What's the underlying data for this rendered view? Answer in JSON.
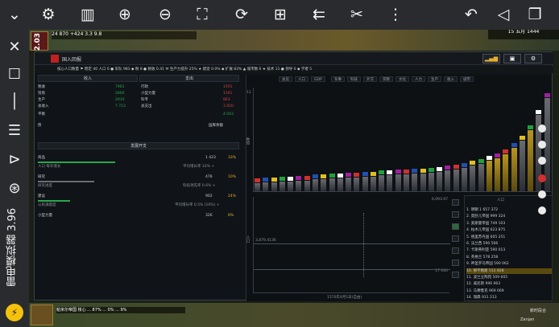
{
  "emulator": {
    "brand": "雷电模拟器 3.96",
    "logo": "⚡",
    "toolbar_icons": [
      "chevron-down-double-icon",
      "gear-icon",
      "sd-card-icon",
      "volume-up-icon",
      "volume-down-icon",
      "screenshot-icon",
      "rotate-icon",
      "add-window-icon",
      "install-apk-icon",
      "scissors-icon",
      "more-icon",
      "back-icon",
      "home-icon",
      "recents-icon"
    ],
    "sidebar_icons": [
      "close-icon",
      "restore-icon",
      "minimize-icon",
      "menu-icon",
      "collapse-icon",
      "gamepad-icon"
    ]
  },
  "game": {
    "topbar": "24 870  +424  3.3  9.8",
    "date": "15 五月 1444",
    "fps": "2.03",
    "dialog_title": "国入回报",
    "resources": "核心人口数量  ⚑ 稳定 40  人口 6  ● 军队 983  ◆ 税 8  ● 税收 0.41  ⚒ 生产力提升 25%  ★ 建造 0.0%  ◆ 扩展 83%  ▲ 城市数 6  ★ 技术 11  ● 领导 0  ◆ 学者 5",
    "left": {
      "income_header": "收入",
      "expense_header": "支出",
      "rows": [
        {
          "label": "税收",
          "val": "7961",
          "r_label": "行政",
          "r_val": "1591"
        },
        {
          "label": "贸易",
          "val": "2800",
          "r_label": "小型力量",
          "r_val": "1591"
        },
        {
          "label": "生产",
          "val": "2910",
          "r_label": "科专",
          "r_val": "863"
        },
        {
          "label": "总收入",
          "val": "7 723",
          "r_label": "总支出",
          "r_val": "3 820"
        }
      ],
      "balance_label": "平衡",
      "balance_val": "4 043",
      "treasury_label": "债",
      "treasury_val": "国库余额",
      "section_header": "发展开支",
      "items": [
        {
          "label": "商品",
          "val": "1 423",
          "pct": "33%",
          "sub": "人口 每年增长",
          "sub2": "平均增长率 10% +"
        },
        {
          "label": "研究",
          "val": "476",
          "pct": "10%",
          "sub": "研究进度",
          "sub2": "科技领先率 0.6% +"
        },
        {
          "label": "建设",
          "val": "902",
          "pct": "24%",
          "sub": "公民满意度",
          "sub2": "平均增长率 0.5% (10%) +"
        },
        {
          "label": "小型力量",
          "val": "326",
          "pct": "8%",
          "sub": "",
          "sub2": ""
        }
      ]
    },
    "right": {
      "tabs": [
        "总览",
        "人口",
        "GDP",
        "军事",
        "科技",
        "外交",
        "宗教",
        "文化",
        "人力",
        "生产",
        "收入",
        "城市"
      ],
      "y_axis_label": "数值",
      "top_axis_value": "11",
      "bottom_y_label": "人口",
      "bottom_axis_max": "6,093.97",
      "bottom_axis_mid": "3,879.4136",
      "bottom_axis_end": "17 060",
      "bottom_x_label": "1570年4月1日(自由)",
      "rank_header": "人口",
      "rank_items": [
        "1. 明朝  1 657 372",
        "2. 莫卧儿帝国  999 324",
        "3. 奥斯曼帝国  749 103",
        "4. 帖木儿帝国  623 875",
        "5. 德里苏丹国  605 251",
        "6. 法兰西  590 566",
        "7. 卡斯蒂利亚  590 013",
        "8. 英格兰  578 258",
        "9. 神圣罗马帝国  590 062",
        "10. 那不勒斯  512 828",
        "11. 波兰立陶宛  509 605",
        "12. 威尼斯  996 963",
        "13. 马穆鲁克  969 069",
        "14. 瑞典  931 213"
      ]
    },
    "bottombar": "帕米尔帝国  核心  ... 87%  ... 0%  ... 9%",
    "bottom_btn": "新时段合",
    "bottom_player": "Zanjan",
    "bar_values": [
      0.08,
      0.09,
      0.09,
      0.1,
      0.1,
      0.11,
      0.11,
      0.12,
      0.12,
      0.13,
      0.13,
      0.14,
      0.14,
      0.15,
      0.15,
      0.16,
      0.16,
      0.17,
      0.17,
      0.18,
      0.18,
      0.19,
      0.2,
      0.21,
      0.22,
      0.24,
      0.26,
      0.28,
      0.31,
      0.34,
      0.38,
      0.44,
      0.52,
      0.62,
      0.78,
      0.95
    ],
    "bar_gold": [
      28,
      29,
      30,
      31,
      33
    ]
  }
}
